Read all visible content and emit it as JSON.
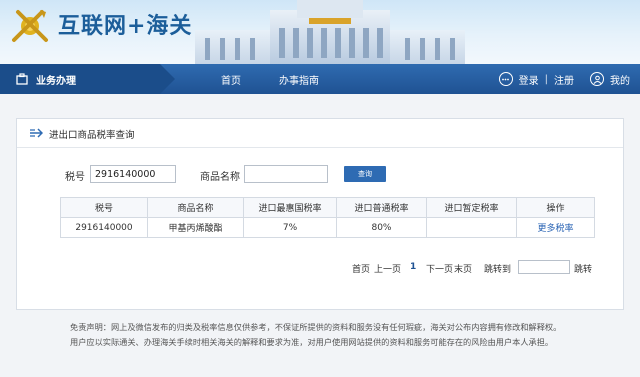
{
  "header": {
    "site_title": "互联网+海关"
  },
  "nav": {
    "section_label": "业务办理",
    "items": [
      "首页",
      "办事指南"
    ],
    "login": "登录",
    "register": "注册",
    "mine": "我的",
    "separator": "|"
  },
  "panel": {
    "title": "进出口商品税率查询"
  },
  "form": {
    "tax_no_label": "税号",
    "tax_no_value": "2916140000",
    "name_label": "商品名称",
    "name_value": "",
    "query_button": "查询"
  },
  "table": {
    "headers": [
      "税号",
      "商品名称",
      "进口最惠国税率",
      "进口普通税率",
      "进口暂定税率",
      "操作"
    ],
    "rows": [
      [
        "2916140000",
        "甲基丙烯酸酯",
        "7%",
        "80%",
        "",
        "更多税率"
      ]
    ]
  },
  "pager": {
    "first": "首页",
    "prev": "上一页",
    "current": "1",
    "next": "下一页",
    "last": "末页",
    "jump_label": "跳转到",
    "jump_button": "跳转"
  },
  "disclaimer": {
    "line1": "免责声明：网上及微信发布的归类及税率信息仅供参考，不保证所提供的资料和服务没有任何瑕疵，海关对公布内容拥有修改和解释权。",
    "line2": "用户应以实际通关、办理海关手续时相关海关的解释和要求为准，对用户使用网站提供的资料和服务可能存在的风险由用户本人承担。"
  },
  "colors": {
    "nav_blue": "#1f5293",
    "link_blue": "#2a64b4",
    "button_blue": "#2e6bb3"
  },
  "icons": [
    "customs-emblem-icon",
    "briefcase-icon",
    "chat-icon",
    "user-icon",
    "tax-query-icon"
  ]
}
